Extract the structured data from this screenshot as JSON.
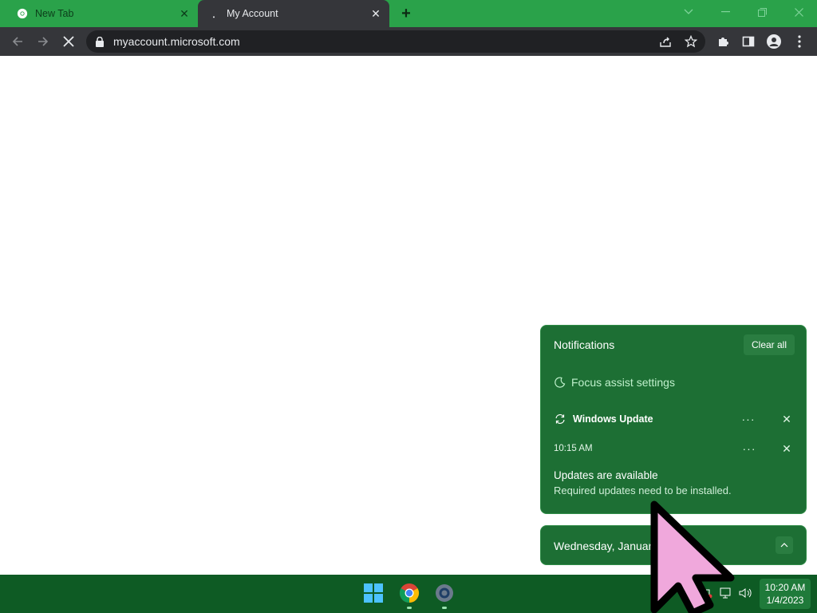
{
  "colors": {
    "tabstrip": "#2aa24a",
    "toolbar": "#35363a",
    "omnibox": "#202124",
    "notification_bg": "#1d6f34",
    "taskbar": "#0e5b24",
    "cursor_fill": "#f0a8dc"
  },
  "browser": {
    "tabs": [
      {
        "title": "New Tab",
        "icon": "chrome-icon",
        "active": false
      },
      {
        "title": "My Account",
        "icon": "loading-icon",
        "active": true
      }
    ],
    "new_tab_label": "+",
    "address": "myaccount.microsoft.com",
    "toolbar_icons": [
      "back-icon",
      "forward-icon",
      "stop-icon",
      "share-icon",
      "star-icon",
      "extensions-icon",
      "side-panel-icon",
      "profile-icon",
      "menu-icon"
    ],
    "window_controls": [
      "tab-search-icon",
      "minimize-icon",
      "restore-icon",
      "close-icon"
    ]
  },
  "notifications": {
    "title": "Notifications",
    "clear_all": "Clear all",
    "focus_assist": "Focus assist settings",
    "items": [
      {
        "app": "Windows Update",
        "time": "10:15 AM",
        "title": "Updates are available",
        "body": "Required updates need to be installed."
      }
    ]
  },
  "calendar": {
    "date_label": "Wednesday, January 4"
  },
  "taskbar": {
    "apps": [
      "windows-start-icon",
      "chrome-icon",
      "settings-icon"
    ],
    "tray_icons": [
      "chevron-up-icon",
      "meet-icon",
      "network-icon",
      "volume-icon"
    ],
    "time": "10:20 AM",
    "date": "1/4/2023"
  }
}
